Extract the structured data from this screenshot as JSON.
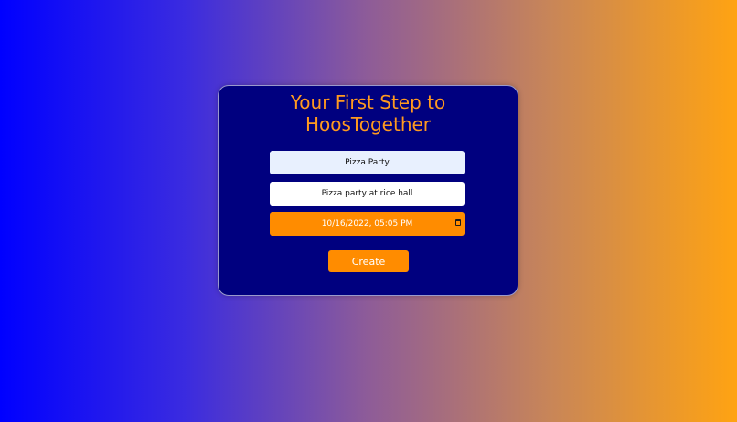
{
  "form": {
    "title_line1": "Your First Step to",
    "title_line2": "HoosTogether",
    "event_name_value": "Pizza Party",
    "event_description_value": "Pizza party at rice hall",
    "event_datetime_value": "10/16/2022, 05:05 PM",
    "create_label": "Create"
  },
  "colors": {
    "card_background": "#00007f",
    "accent": "#ff8c00",
    "title_color": "#ff9a1f",
    "gradient_left": "#0000ff",
    "gradient_right": "#ffa312"
  },
  "icons": {
    "datetime_picker": "calendar-icon"
  }
}
